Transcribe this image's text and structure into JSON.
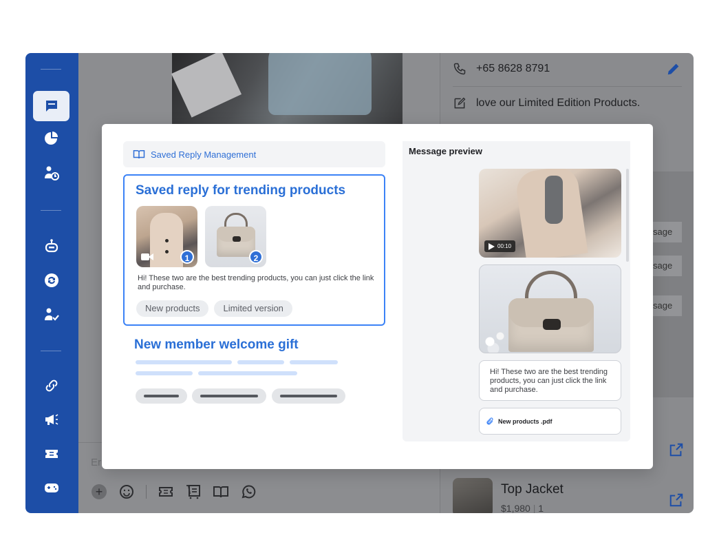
{
  "colors": {
    "rail": "#1d4ea7",
    "accent": "#2f6fd6",
    "selected_border": "#3b82f6"
  },
  "nav": {
    "icons": [
      "chat-icon",
      "pie-chart-icon",
      "user-clock-icon",
      "robot-icon",
      "sync-icon",
      "user-check-icon",
      "link-icon",
      "megaphone-icon",
      "ticket-icon",
      "gamepad-icon"
    ],
    "active": "chat-icon"
  },
  "chat": {
    "composer_placeholder": "Er",
    "toolbar_icons": [
      "plus-icon",
      "emoji-icon",
      "coupon-icon",
      "product-icon",
      "saved-reply-icon",
      "whatsapp-icon"
    ]
  },
  "contact": {
    "phone": "+65 8628 8791",
    "note": "love our Limited Edition Products.",
    "ghost_buttons": [
      "sage",
      "sage",
      "sage"
    ],
    "product": {
      "name": "Top Jacket",
      "price": "$1,980",
      "qty": "1"
    }
  },
  "modal": {
    "header_label": "Saved Reply Management",
    "selected_reply": {
      "title": "Saved reply for trending products",
      "media": [
        {
          "type": "video",
          "badge": "1"
        },
        {
          "type": "image",
          "badge": "2"
        }
      ],
      "message": "Hi! These two are the best trending products, you can just click the link and purchase.",
      "tags": [
        "New products",
        "Limited version"
      ]
    },
    "second_reply": {
      "title": "New member welcome gift"
    },
    "preview": {
      "title": "Message preview",
      "video_duration": "00:10",
      "message": "Hi! These two are the best trending products, you can just click the link and purchase.",
      "attachment": "New products .pdf"
    }
  }
}
